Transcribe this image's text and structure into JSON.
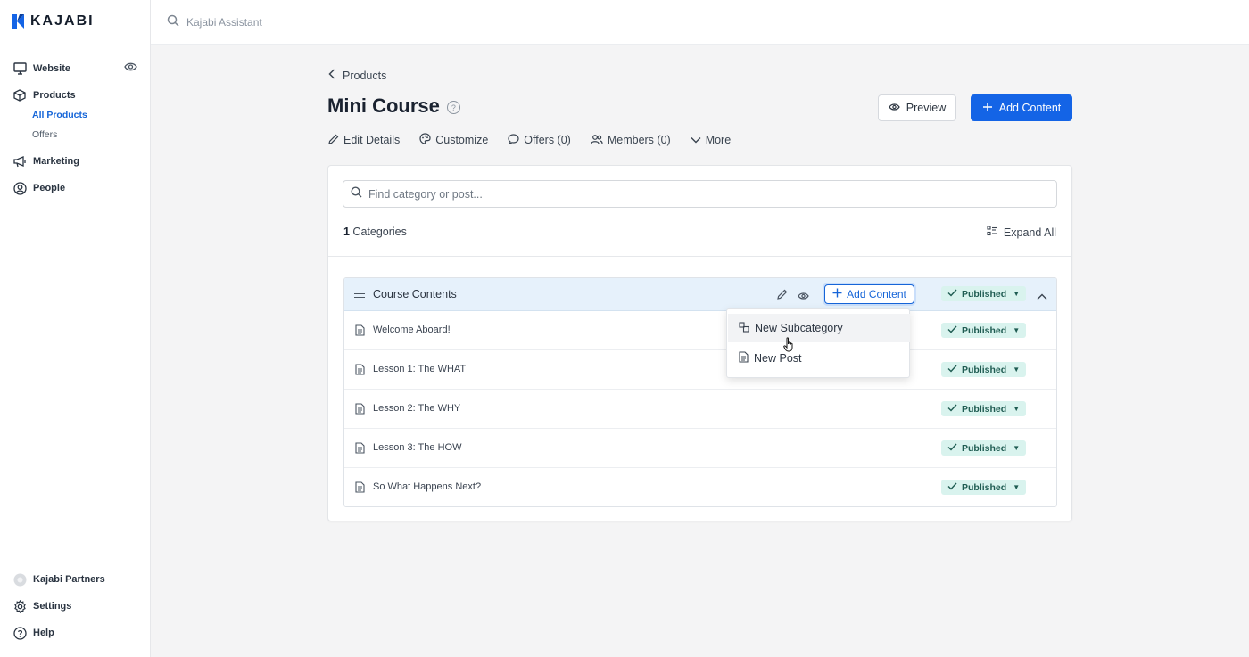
{
  "brand": {
    "name": "KAJABI",
    "accent": "#1464e6"
  },
  "sidebar": {
    "items": [
      {
        "label": "Website",
        "icon": "monitor-icon"
      },
      {
        "label": "Products",
        "icon": "box-icon",
        "children": [
          {
            "label": "All Products",
            "active": true
          },
          {
            "label": "Offers",
            "active": false
          }
        ]
      },
      {
        "label": "Marketing",
        "icon": "megaphone-icon"
      },
      {
        "label": "People",
        "icon": "person-circle-icon"
      }
    ],
    "bottom": [
      {
        "label": "Kajabi Partners",
        "icon": "partners-avatar-icon"
      },
      {
        "label": "Settings",
        "icon": "gear-icon"
      },
      {
        "label": "Help",
        "icon": "help-circle-icon"
      }
    ]
  },
  "topbar": {
    "assistant_placeholder": "Kajabi Assistant"
  },
  "header": {
    "back_label": "Products",
    "title": "Mini Course",
    "preview_label": "Preview",
    "add_content_label": "Add Content",
    "tabs": [
      {
        "label": "Edit Details",
        "icon": "pencil-icon"
      },
      {
        "label": "Customize",
        "icon": "palette-icon"
      },
      {
        "label": "Offers (0)",
        "icon": "speech-bubble-icon"
      },
      {
        "label": "Members (0)",
        "icon": "members-icon"
      },
      {
        "label": "More",
        "icon": "chevron-down-icon"
      }
    ]
  },
  "content": {
    "search_placeholder": "Find category or post...",
    "category_count": "1",
    "category_count_suffix": " Categories",
    "expand_label": "Expand All",
    "category": {
      "title": "Course Contents",
      "add_content_label": "Add Content",
      "status": "Published",
      "posts": [
        {
          "title": "Welcome Aboard!",
          "status": "Published"
        },
        {
          "title": "Lesson 1: The WHAT",
          "status": "Published"
        },
        {
          "title": "Lesson 2: The WHY",
          "status": "Published"
        },
        {
          "title": "Lesson 3: The HOW",
          "status": "Published"
        },
        {
          "title": "So What Happens Next?",
          "status": "Published"
        }
      ]
    }
  },
  "dropdown": {
    "items": [
      {
        "label": "New Subcategory",
        "icon": "subcategory-icon",
        "hovered": true
      },
      {
        "label": "New Post",
        "icon": "document-icon",
        "hovered": false
      }
    ]
  },
  "colors": {
    "published_bg": "#d9f3ee",
    "published_text": "#1f5c52",
    "category_head_bg": "#e6f1fb"
  }
}
